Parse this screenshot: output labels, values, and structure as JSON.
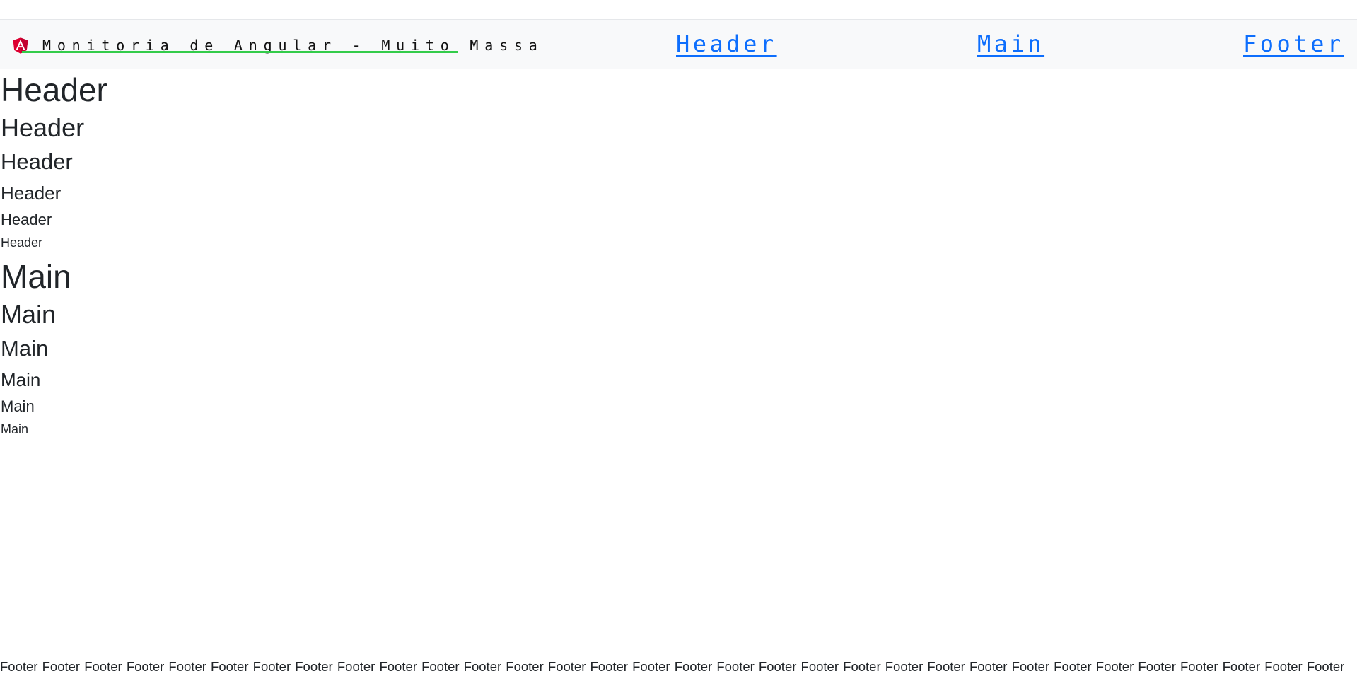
{
  "navbar": {
    "brand_text": "Monitoria de Angular - Muito Massa",
    "brand_icon": "angular-logo-icon",
    "links": [
      {
        "label": "Header"
      },
      {
        "label": "Main"
      },
      {
        "label": "Footer"
      }
    ],
    "colors": {
      "link": "#0d6efd",
      "brand_underline": "#33cc4a",
      "navbar_bg": "#f8f9fa",
      "logo_red": "#dd0031"
    }
  },
  "header_section": {
    "h1": "Header",
    "h2": "Header",
    "h3": "Header",
    "h4": "Header",
    "h5": "Header",
    "h6": "Header"
  },
  "main_section": {
    "h1": "Main",
    "h2": "Main",
    "h3": "Main",
    "h4": "Main",
    "h5": "Main",
    "h6": "Main"
  },
  "footer": {
    "text": "Footer Footer Footer Footer Footer Footer Footer Footer Footer Footer Footer Footer Footer Footer Footer Footer Footer Footer Footer Footer Footer Footer Footer Footer Footer Footer Footer Footer Footer Footer Footer Footer"
  }
}
